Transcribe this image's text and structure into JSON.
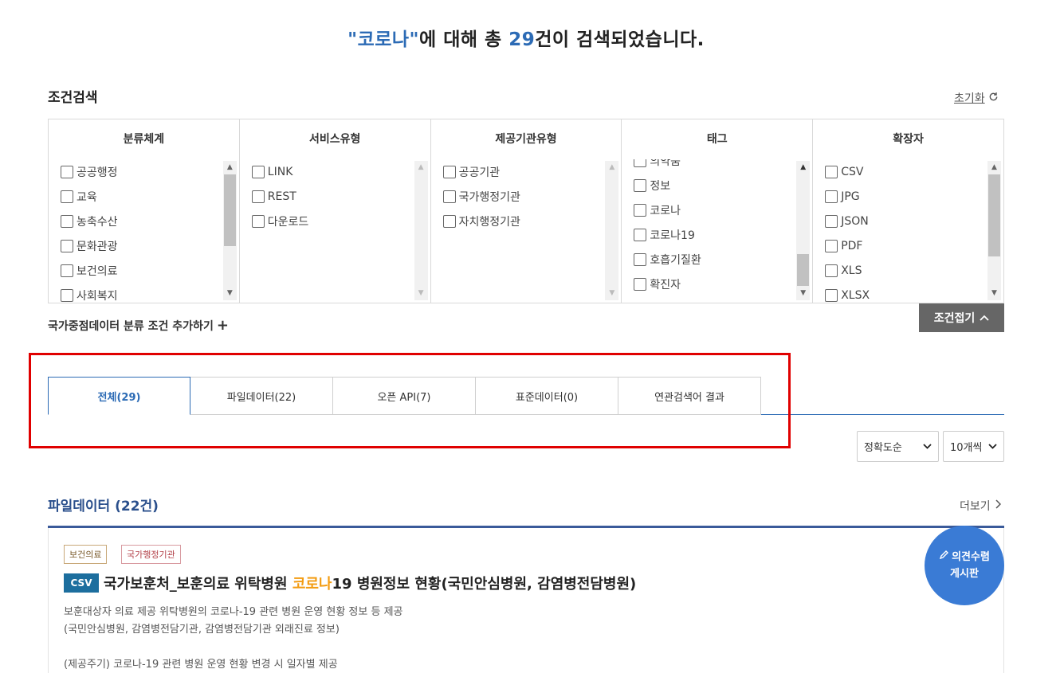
{
  "headline": {
    "open_quote": "\"",
    "keyword": "코로나",
    "close_quote": "\"",
    "mid": "에 대해 총 ",
    "count": "29",
    "tail": "건이 검색되었습니다."
  },
  "condition": {
    "title": "조건검색",
    "reset_label": "초기화",
    "columns": [
      {
        "header": "분류체계",
        "options": [
          "공공행정",
          "교육",
          "농축수산",
          "문화관광",
          "보건의료",
          "사회복지"
        ]
      },
      {
        "header": "서비스유형",
        "options": [
          "LINK",
          "REST",
          "다운로드"
        ]
      },
      {
        "header": "제공기관유형",
        "options": [
          "공공기관",
          "국가행정기관",
          "자치행정기관"
        ]
      },
      {
        "header": "태그",
        "options": [
          "의약품",
          "정보",
          "코로나",
          "코로나19",
          "호흡기질환",
          "확진자"
        ]
      },
      {
        "header": "확장자",
        "options": [
          "CSV",
          "JPG",
          "JSON",
          "PDF",
          "XLS",
          "XLSX"
        ]
      }
    ],
    "national_label": "국가중점데이터 분류 조건 추가하기",
    "collapse_label": "조건접기"
  },
  "tabs": [
    "전체(29)",
    "파일데이터(22)",
    "오픈 API(7)",
    "표준데이터(0)",
    "연관검색어 결과"
  ],
  "sort": {
    "order": "정확도순",
    "per_page": "10개씩"
  },
  "section": {
    "title": "파일데이터 (22건)",
    "more_label": "더보기"
  },
  "result": {
    "tags": [
      "보건의료",
      "국가행정기관"
    ],
    "format": "CSV",
    "title_pre": "국가보훈처_보훈의료 위탁병원 ",
    "title_kw": "코로나",
    "title_post": "19 병원정보 현황(국민안심병원, 감염병전담병원)",
    "desc1": "보훈대상자 의료 제공 위탁병원의 코로나-19 관련 병원 운영 현황 정보 등 제공",
    "desc2": "(국민안심병원, 감염병전담기관, 감염병전담기관 외래진료 정보)",
    "desc3": "(제공주기) 코로나-19 관련 병원 운영 현황 변경 시 일자별 제공"
  },
  "fab": {
    "line1": "의견수렴",
    "line2": "게시판"
  },
  "colors": {
    "accent": "#2c6bb5",
    "highlight_box": "#e00000",
    "keyword": "#f39c12",
    "csv_badge": "#1c6e9e",
    "fab": "#3a7bd5"
  },
  "icons": {
    "reset": "refresh-icon",
    "plus": "plus-icon",
    "chevron_up": "chevron-up-icon",
    "chevron_down": "chevron-down-icon",
    "chevron_right": "chevron-right-icon",
    "pencil": "pencil-icon"
  }
}
